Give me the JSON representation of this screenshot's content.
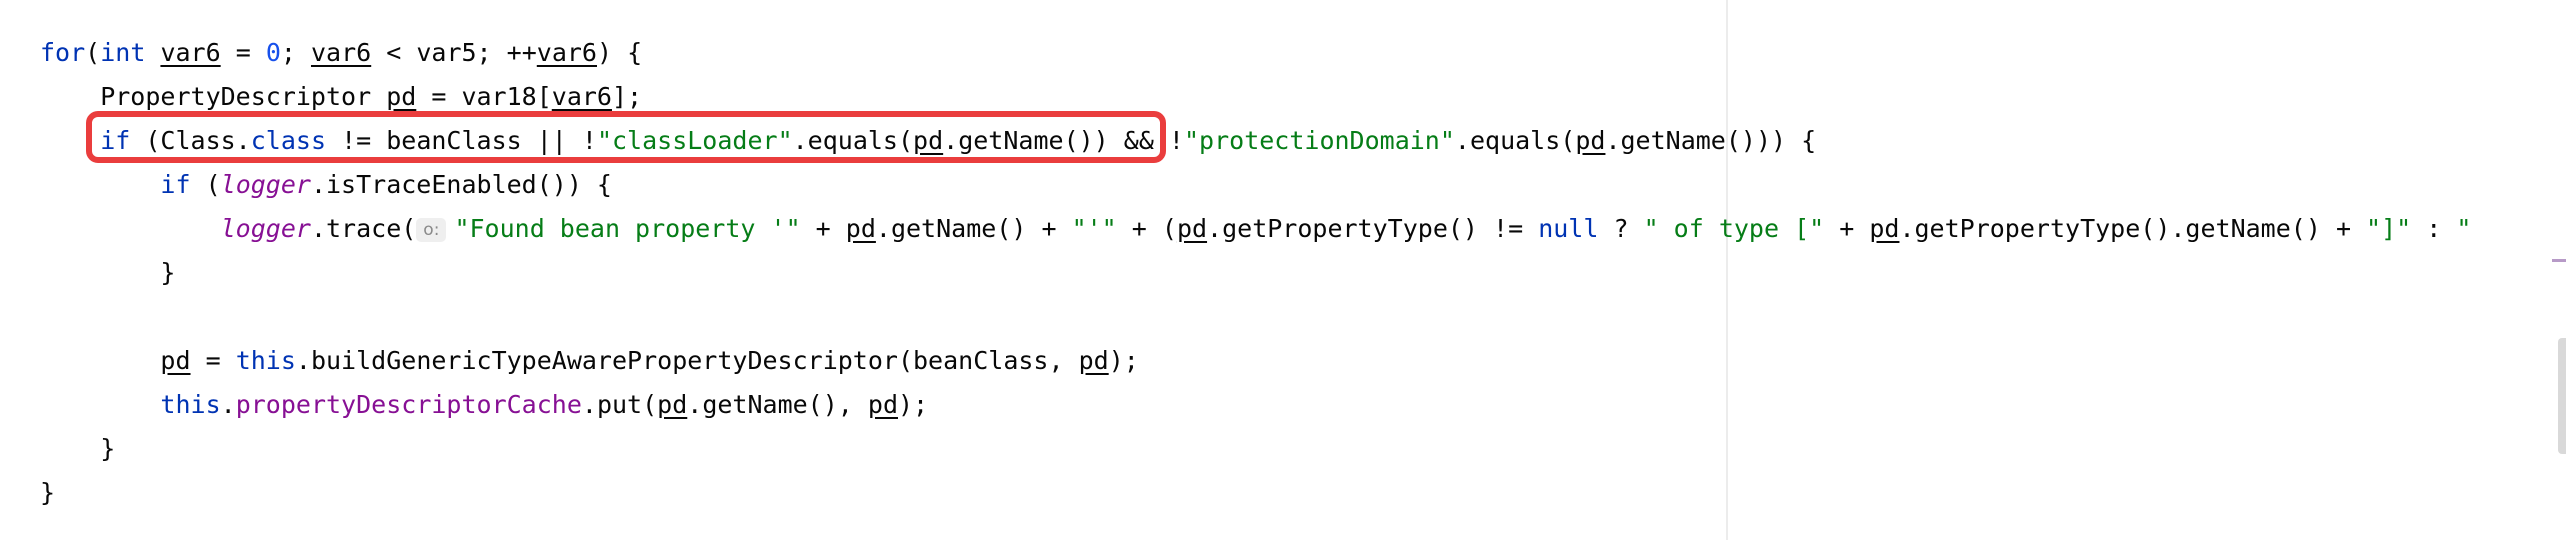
{
  "editor": {
    "lines": [
      {
        "tokens": [
          {
            "text": "for",
            "cls": "kw"
          },
          {
            "text": "("
          },
          {
            "text": "int",
            "cls": "kw"
          },
          {
            "text": " "
          },
          {
            "text": "var6",
            "cls": "local-u"
          },
          {
            "text": " = "
          },
          {
            "text": "0",
            "cls": "num"
          },
          {
            "text": "; "
          },
          {
            "text": "var6",
            "cls": "local-u"
          },
          {
            "text": " < var5; ++"
          },
          {
            "text": "var6",
            "cls": "local-u"
          },
          {
            "text": ") {"
          }
        ]
      },
      {
        "tokens": [
          {
            "text": "    PropertyDescriptor "
          },
          {
            "text": "pd",
            "cls": "local-u"
          },
          {
            "text": " = var18["
          },
          {
            "text": "var6",
            "cls": "local-u"
          },
          {
            "text": "];"
          }
        ]
      },
      {
        "tokens": [
          {
            "text": "    "
          },
          {
            "text": "if",
            "cls": "kw"
          },
          {
            "text": " (Class."
          },
          {
            "text": "class",
            "cls": "kw"
          },
          {
            "text": " != beanClass || !"
          },
          {
            "text": "\"classLoader\"",
            "cls": "str"
          },
          {
            "text": ".equals("
          },
          {
            "text": "pd",
            "cls": "local-u"
          },
          {
            "text": ".getName()) && !"
          },
          {
            "text": "\"protectionDomain\"",
            "cls": "str"
          },
          {
            "text": ".equals("
          },
          {
            "text": "pd",
            "cls": "local-u"
          },
          {
            "text": ".getName())) {"
          }
        ]
      },
      {
        "tokens": [
          {
            "text": "        "
          },
          {
            "text": "if",
            "cls": "kw"
          },
          {
            "text": " ("
          },
          {
            "text": "logger",
            "cls": "italic-field"
          },
          {
            "text": ".isTraceEnabled()) {"
          }
        ]
      },
      {
        "tokens": [
          {
            "text": "            "
          },
          {
            "text": "logger",
            "cls": "italic-field"
          },
          {
            "text": ".trace("
          },
          {
            "text": "o:",
            "cls": "hint"
          },
          {
            "text": "\"Found bean property '\"",
            "cls": "str"
          },
          {
            "text": " + "
          },
          {
            "text": "pd",
            "cls": "local-u"
          },
          {
            "text": ".getName() + "
          },
          {
            "text": "\"'\"",
            "cls": "str"
          },
          {
            "text": " + ("
          },
          {
            "text": "pd",
            "cls": "local-u"
          },
          {
            "text": ".getPropertyType() != "
          },
          {
            "text": "null",
            "cls": "kw"
          },
          {
            "text": " ? "
          },
          {
            "text": "\" of type [\"",
            "cls": "str"
          },
          {
            "text": " + "
          },
          {
            "text": "pd",
            "cls": "local-u"
          },
          {
            "text": ".getPropertyType().getName() + "
          },
          {
            "text": "\"]\"",
            "cls": "str"
          },
          {
            "text": " : "
          },
          {
            "text": "\"",
            "cls": "str"
          }
        ]
      },
      {
        "tokens": [
          {
            "text": "        }"
          }
        ]
      },
      {
        "tokens": [
          {
            "text": ""
          }
        ]
      },
      {
        "tokens": [
          {
            "text": "        "
          },
          {
            "text": "pd",
            "cls": "local-u"
          },
          {
            "text": " = "
          },
          {
            "text": "this",
            "cls": "kw"
          },
          {
            "text": ".buildGenericTypeAwarePropertyDescriptor(beanClass, "
          },
          {
            "text": "pd",
            "cls": "local-u"
          },
          {
            "text": ");"
          }
        ]
      },
      {
        "tokens": [
          {
            "text": "        "
          },
          {
            "text": "this",
            "cls": "kw"
          },
          {
            "text": "."
          },
          {
            "text": "propertyDescriptorCache",
            "cls": "field"
          },
          {
            "text": ".put("
          },
          {
            "text": "pd",
            "cls": "local-u"
          },
          {
            "text": ".getName(), "
          },
          {
            "text": "pd",
            "cls": "local-u"
          },
          {
            "text": ");"
          }
        ]
      },
      {
        "tokens": [
          {
            "text": "    }"
          }
        ]
      },
      {
        "tokens": [
          {
            "text": "}"
          }
        ]
      }
    ]
  },
  "colors": {
    "keyword": "#0033b3",
    "number": "#1750eb",
    "string": "#067d17",
    "field": "#871094",
    "highlight_box": "#ea3d3d"
  }
}
